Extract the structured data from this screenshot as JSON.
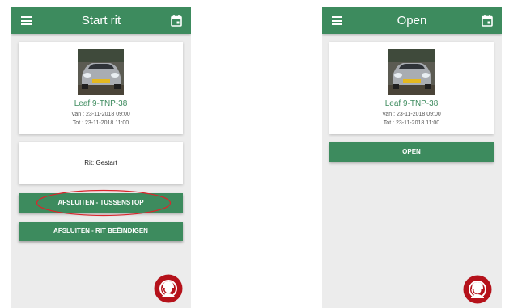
{
  "colors": {
    "primary_green": "#3d8b5e",
    "screen_background": "#ececec",
    "card_background": "#ffffff",
    "fab_red": "#b5121b",
    "annotation_red": "#d9262c"
  },
  "icons": {
    "menu": "menu-icon",
    "calendar": "calendar-icon",
    "support": "support-agent-icon"
  },
  "screens": {
    "left": {
      "header": {
        "title": "Start rit"
      },
      "car": {
        "name": "Leaf 9-TNP-38",
        "from": "Van : 23-11-2018 09:00",
        "to": "Tot : 23-11-2018 11:00"
      },
      "status": {
        "text": "Rit: Gestart"
      },
      "actions": {
        "tussenstop_label": "AFSLUITEN - TUSSENSTOP",
        "beeindigen_label": "AFSLUITEN - RIT BEËINDIGEN"
      }
    },
    "right": {
      "header": {
        "title": "Open"
      },
      "car": {
        "name": "Leaf 9-TNP-38",
        "from": "Van : 23-11-2018 09:00",
        "to": "Tot : 23-11-2018 11:00"
      },
      "actions": {
        "open_label": "OPEN"
      }
    }
  }
}
